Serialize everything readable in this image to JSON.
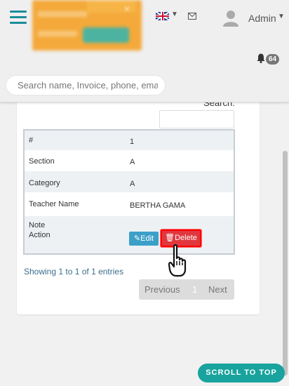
{
  "header": {
    "admin_label": "Admin",
    "notification_count": "64",
    "search_placeholder": "Search name, Invoice, phone, ema"
  },
  "datatable": {
    "search_label": "Search:",
    "rows": [
      {
        "label": "#",
        "value": "1"
      },
      {
        "label": "Section",
        "value": "A"
      },
      {
        "label": "Category",
        "value": "A"
      },
      {
        "label": "Teacher Name",
        "value": "BERTHA GAMA"
      },
      {
        "label": "Note",
        "value": ""
      },
      {
        "label": "Action",
        "value": ""
      }
    ],
    "edit_label": "Edit",
    "delete_label": "Delete",
    "showing_text": "Showing 1 to 1 of 1 entries",
    "pagination": {
      "previous": "Previous",
      "current": "1",
      "next": "Next"
    }
  },
  "scroll_top_label": "SCROLL TO TOP",
  "colors": {
    "accent": "#1b8d9a",
    "edit": "#3c9fc8",
    "delete": "#e0383e",
    "scroll_top": "#18a39e"
  }
}
